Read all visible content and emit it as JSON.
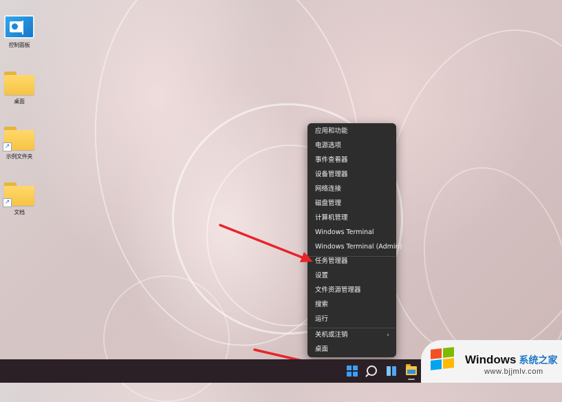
{
  "desktop": {
    "icons": [
      {
        "label": "控制面板",
        "icon": "control-panel-icon"
      },
      {
        "label": "桌面",
        "icon": "folder-icon"
      },
      {
        "label": "示例文件夹",
        "icon": "folder-shortcut-icon"
      },
      {
        "label": "文档",
        "icon": "folder-shortcut-icon"
      }
    ]
  },
  "context_menu": {
    "items": [
      {
        "label": "应用和功能"
      },
      {
        "label": "电源选项"
      },
      {
        "label": "事件查看器"
      },
      {
        "label": "设备管理器"
      },
      {
        "label": "网络连接"
      },
      {
        "label": "磁盘管理"
      },
      {
        "label": "计算机管理"
      },
      {
        "label": "Windows Terminal"
      },
      {
        "label": "Windows Terminal (Admin)"
      },
      {
        "label": "任务管理器"
      },
      {
        "label": "设置"
      },
      {
        "label": "文件资源管理器"
      },
      {
        "label": "搜索"
      },
      {
        "label": "运行"
      },
      {
        "label": "关机或注销",
        "submenu_glyph": "›"
      },
      {
        "label": "桌面"
      }
    ]
  },
  "taskbar": {
    "buttons": [
      "start-icon",
      "search-icon",
      "widgets-icon",
      "file-explorer-icon"
    ]
  },
  "watermark": {
    "brand": "Windows",
    "brand_cn": "系统之家",
    "url": "www.bjjmlv.com"
  },
  "colors": {
    "menu_bg": "#2d2d2d",
    "menu_text": "#f0f0f0",
    "taskbar_bg": "#2a2025",
    "arrow": "#e8242a",
    "start_blue": "#3aa0ff"
  }
}
